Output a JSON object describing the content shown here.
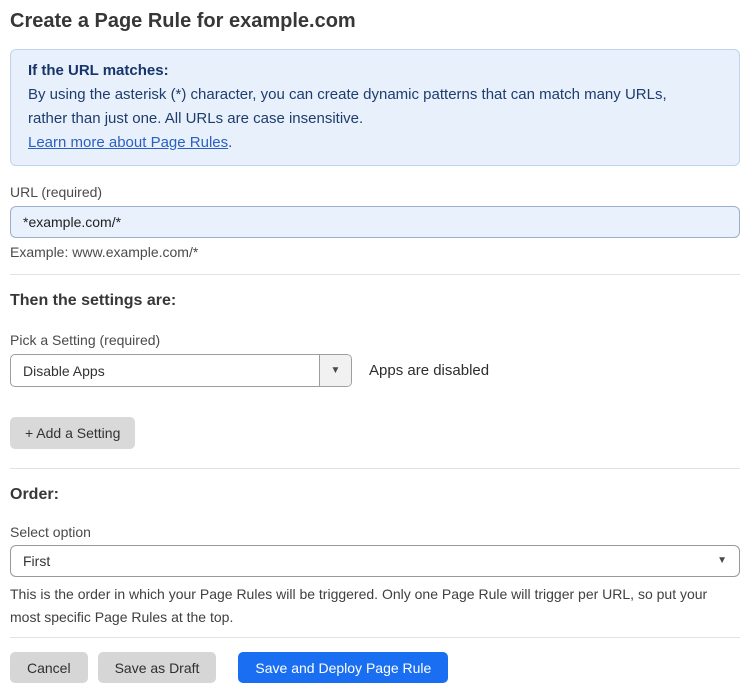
{
  "page": {
    "title": "Create a Page Rule for example.com"
  },
  "info_box": {
    "heading": "If the URL matches:",
    "body": "By using the asterisk (*) character, you can create dynamic patterns that can match many URLs, rather than just one. All URLs are case insensitive.",
    "link_label": "Learn more about Page Rules",
    "link_suffix": "."
  },
  "url_field": {
    "label": "URL (required)",
    "value": "*example.com/*",
    "helper": "Example: www.example.com/*"
  },
  "settings_section": {
    "heading": "Then the settings are:",
    "picker_label": "Pick a Setting (required)",
    "picker_value": "Disable Apps",
    "status_text": "Apps are disabled",
    "add_setting_label": "+ Add a Setting"
  },
  "order_section": {
    "heading": "Order:",
    "select_label": "Select option",
    "select_value": "First",
    "helper": "This is the order in which your Page Rules will be triggered. Only one Page Rule will trigger per URL, so put your most specific Page Rules at the top."
  },
  "actions": {
    "cancel_label": "Cancel",
    "save_draft_label": "Save as Draft",
    "save_deploy_label": "Save and Deploy Page Rule"
  },
  "icons": {
    "caret_down": "▼"
  },
  "colors": {
    "info_bg": "#e8f1fb",
    "info_border": "#bdd4ee",
    "info_text": "#1e3c6e",
    "link_blue": "#2a5fc4",
    "input_bg": "#e9f1fc",
    "gray_button": "#d6d6d6",
    "primary_button": "#1a6ef2"
  }
}
